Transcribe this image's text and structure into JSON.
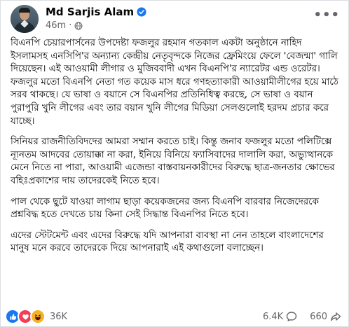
{
  "post": {
    "author": "Md Sarjis Alam",
    "time": "46m",
    "time_separator": "·",
    "more_label": "•••",
    "paragraphs": [
      "বিএনপি চেয়ারপার্সনের উপদেষ্টা ফজলুর রহমান গতকাল একটা অনুষ্ঠানে নাহিদ ইসলামসহ এনসিপি'র অন্যান্য কেন্দ্রীয় নেতৃবৃন্দকে নিজের ফ্রেমিংয়ে ফেলে 'বেজন্মা' গালি দিয়েছেন। এই আওয়ামী লীগার ও মুজিববাদী এখন বিএনপি'র ন্যারেটর এন্ড ওরেটর। ফজলুর মতো বিএনপি নেতা গত কয়েক মাস ধরে গণহত্যাকারী আওয়ামীলীগের হয়ে মাঠে সরব থাকছে। যে ভাষা ও বয়ানে সে বিএনপির প্রতিনিধিত্ব করছে, সে ভাষা ও বয়ান পুরাপুরি খুনি লীগের এবং তার বয়ান খুনি লীগের মিডিয়া সেলগুলোই হরদম প্রচার করে যাচ্ছে।",
      "সিনিয়র রাজনীতিবিদদের আমরা সম্মান করতে চাই। কিন্তু জনাব ফজলুর মতো পলিটিক্সে ন্যূনতম আদবের তোয়াক্কা না করা, ইনিয়ে বিনিয়ে ফ্যাসিবাদের দালালি করা, অভ্যুত্থানকে মেনে নিতে না পারা, আওয়ামী এজেন্ডা বাস্তবায়নকারীদের বিরুদ্ধে ছাত্র-জনতার ক্ষোভের বহিঃপ্রকাশের দায় তাদেরকেই নিতে হবে।",
      "পাল থেকে ছুটে যাওয়া লাগাম ছাড়া কয়েকজনের জন্য বিএনপি বারবার নিজেদেরকে প্রশ্নবিদ্ধ হতে দেখতে চায় কিনা সেই সিদ্ধান্ত বিএনপির নিতে হবে।",
      "এদের স্টেটমেন্ট এবং এদের বিরুদ্ধে যদি আপনারা ব্যবস্থা না নেন তাহলে বাংলাদেশের মানুষ মনে করবে তাদেরকে দিয়ে আপনারাই এই কথাগুলো বলাচ্ছেন।"
    ]
  },
  "footer": {
    "reactions_count": "36K",
    "comments_count": "6.4K",
    "shares_count": "660"
  },
  "colors": {
    "like": "#1877f2",
    "love": "#f33e58",
    "haha": "#f7b125",
    "verified": "#1877f2",
    "secondary_text": "#65676b"
  },
  "icons": [
    "avatar",
    "verified-badge-icon",
    "globe-icon",
    "more-icon",
    "like-reaction-icon",
    "love-reaction-icon",
    "haha-reaction-icon",
    "comment-icon",
    "share-icon"
  ]
}
